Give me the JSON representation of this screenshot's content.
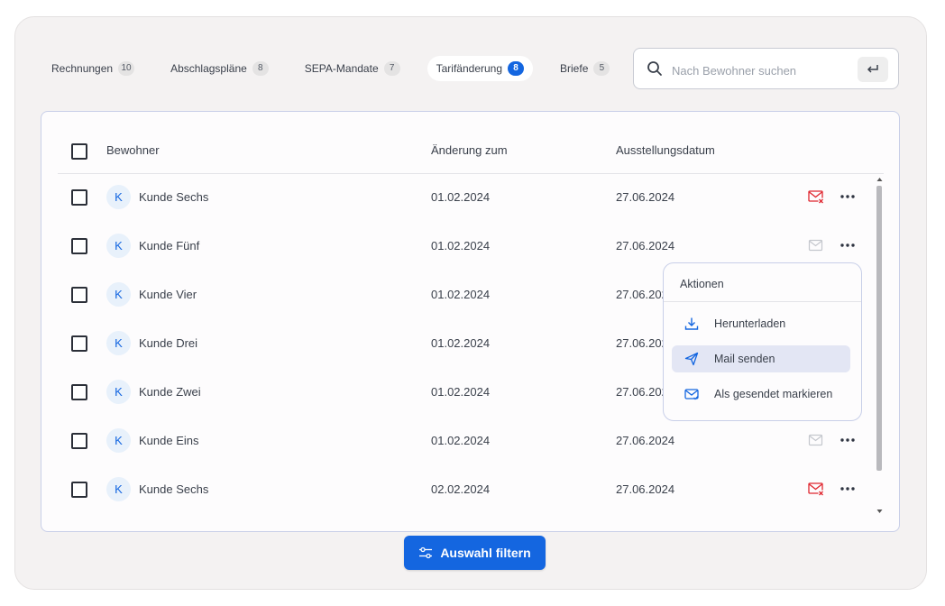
{
  "tabs": [
    {
      "label": "Rechnungen",
      "count": "10",
      "active": false
    },
    {
      "label": "Abschlagspläne",
      "count": "8",
      "active": false
    },
    {
      "label": "SEPA-Mandate",
      "count": "7",
      "active": false
    },
    {
      "label": "Tarifänderung",
      "count": "8",
      "active": true
    },
    {
      "label": "Briefe",
      "count": "5",
      "active": false
    }
  ],
  "search": {
    "placeholder": "Nach Bewohner suchen"
  },
  "table": {
    "headers": {
      "resident": "Bewohner",
      "change": "Änderung zum",
      "issue": "Ausstellungsdatum"
    },
    "rows": [
      {
        "initial": "K",
        "name": "Kunde Sechs",
        "change": "01.02.2024",
        "issued": "27.06.2024",
        "mail_status": "error"
      },
      {
        "initial": "K",
        "name": "Kunde Fünf",
        "change": "01.02.2024",
        "issued": "27.06.2024",
        "mail_status": "neutral"
      },
      {
        "initial": "K",
        "name": "Kunde Vier",
        "change": "01.02.2024",
        "issued": "27.06.2024",
        "mail_status": "hidden"
      },
      {
        "initial": "K",
        "name": "Kunde Drei",
        "change": "01.02.2024",
        "issued": "27.06.2024",
        "mail_status": "hidden"
      },
      {
        "initial": "K",
        "name": "Kunde Zwei",
        "change": "01.02.2024",
        "issued": "27.06.2024",
        "mail_status": "hidden"
      },
      {
        "initial": "K",
        "name": "Kunde Eins",
        "change": "01.02.2024",
        "issued": "27.06.2024",
        "mail_status": "neutral"
      },
      {
        "initial": "K",
        "name": "Kunde Sechs",
        "change": "02.02.2024",
        "issued": "27.06.2024",
        "mail_status": "error"
      }
    ]
  },
  "actions_menu": {
    "title": "Aktionen",
    "items": [
      {
        "label": "Herunterladen",
        "icon": "download-icon"
      },
      {
        "label": "Mail senden",
        "icon": "send-icon"
      },
      {
        "label": "Als gesendet markieren",
        "icon": "mail-check-icon"
      }
    ]
  },
  "filter_button": {
    "label": "Auswahl filtern",
    "icon": "sliders-icon"
  },
  "colors": {
    "accent": "#1466e0",
    "error": "#e0262f",
    "neutral_icon": "#c4c7cd"
  }
}
